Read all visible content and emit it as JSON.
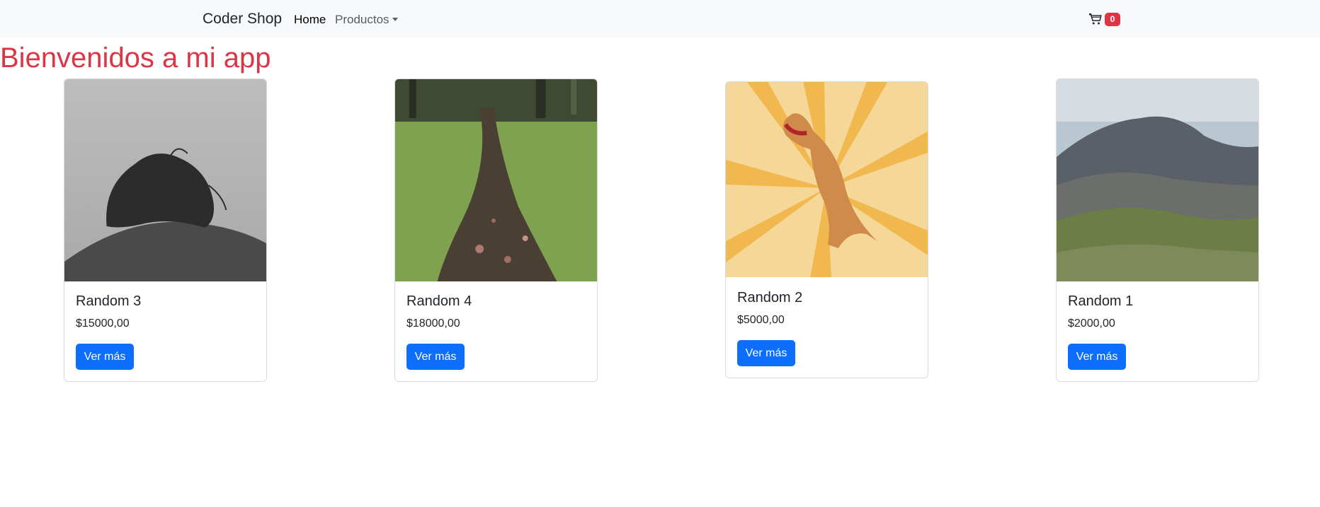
{
  "navbar": {
    "brand": "Coder Shop",
    "home_label": "Home",
    "productos_label": "Productos",
    "cart_count": "0"
  },
  "main": {
    "heading": "Bienvenidos a mi app",
    "heading_color": "#dc3545",
    "button_color": "#0d6efd",
    "products": [
      {
        "title": "Random 3",
        "price": "$15000,00",
        "button": "Ver más"
      },
      {
        "title": "Random 4",
        "price": "$18000,00",
        "button": "Ver más"
      },
      {
        "title": "Random 2",
        "price": "$5000,00",
        "button": "Ver más"
      },
      {
        "title": "Random 1",
        "price": "$2000,00",
        "button": "Ver más"
      }
    ]
  }
}
